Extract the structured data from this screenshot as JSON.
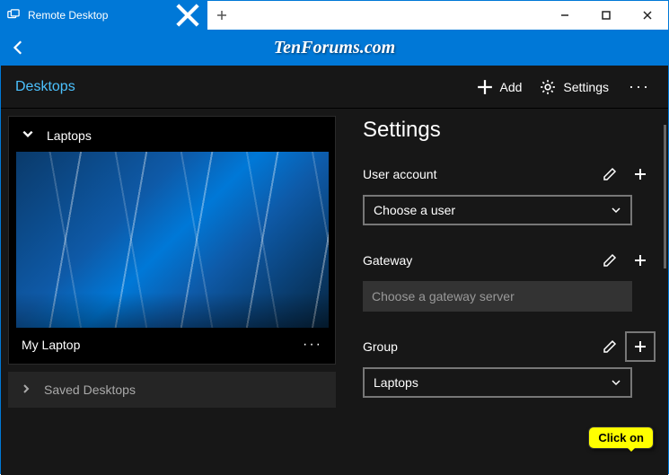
{
  "titlebar": {
    "tab_title": "Remote Desktop"
  },
  "watermark": "TenForums.com",
  "toolbar": {
    "title": "Desktops",
    "add_label": "Add",
    "settings_label": "Settings"
  },
  "left_panel": {
    "group_name": "Laptops",
    "desktop_name": "My Laptop",
    "saved_section": "Saved Desktops"
  },
  "settings_panel": {
    "title": "Settings",
    "user_label": "User account",
    "user_placeholder": "Choose a user",
    "gateway_label": "Gateway",
    "gateway_placeholder": "Choose a gateway server",
    "group_label": "Group",
    "group_value": "Laptops"
  },
  "callout": "Click on"
}
